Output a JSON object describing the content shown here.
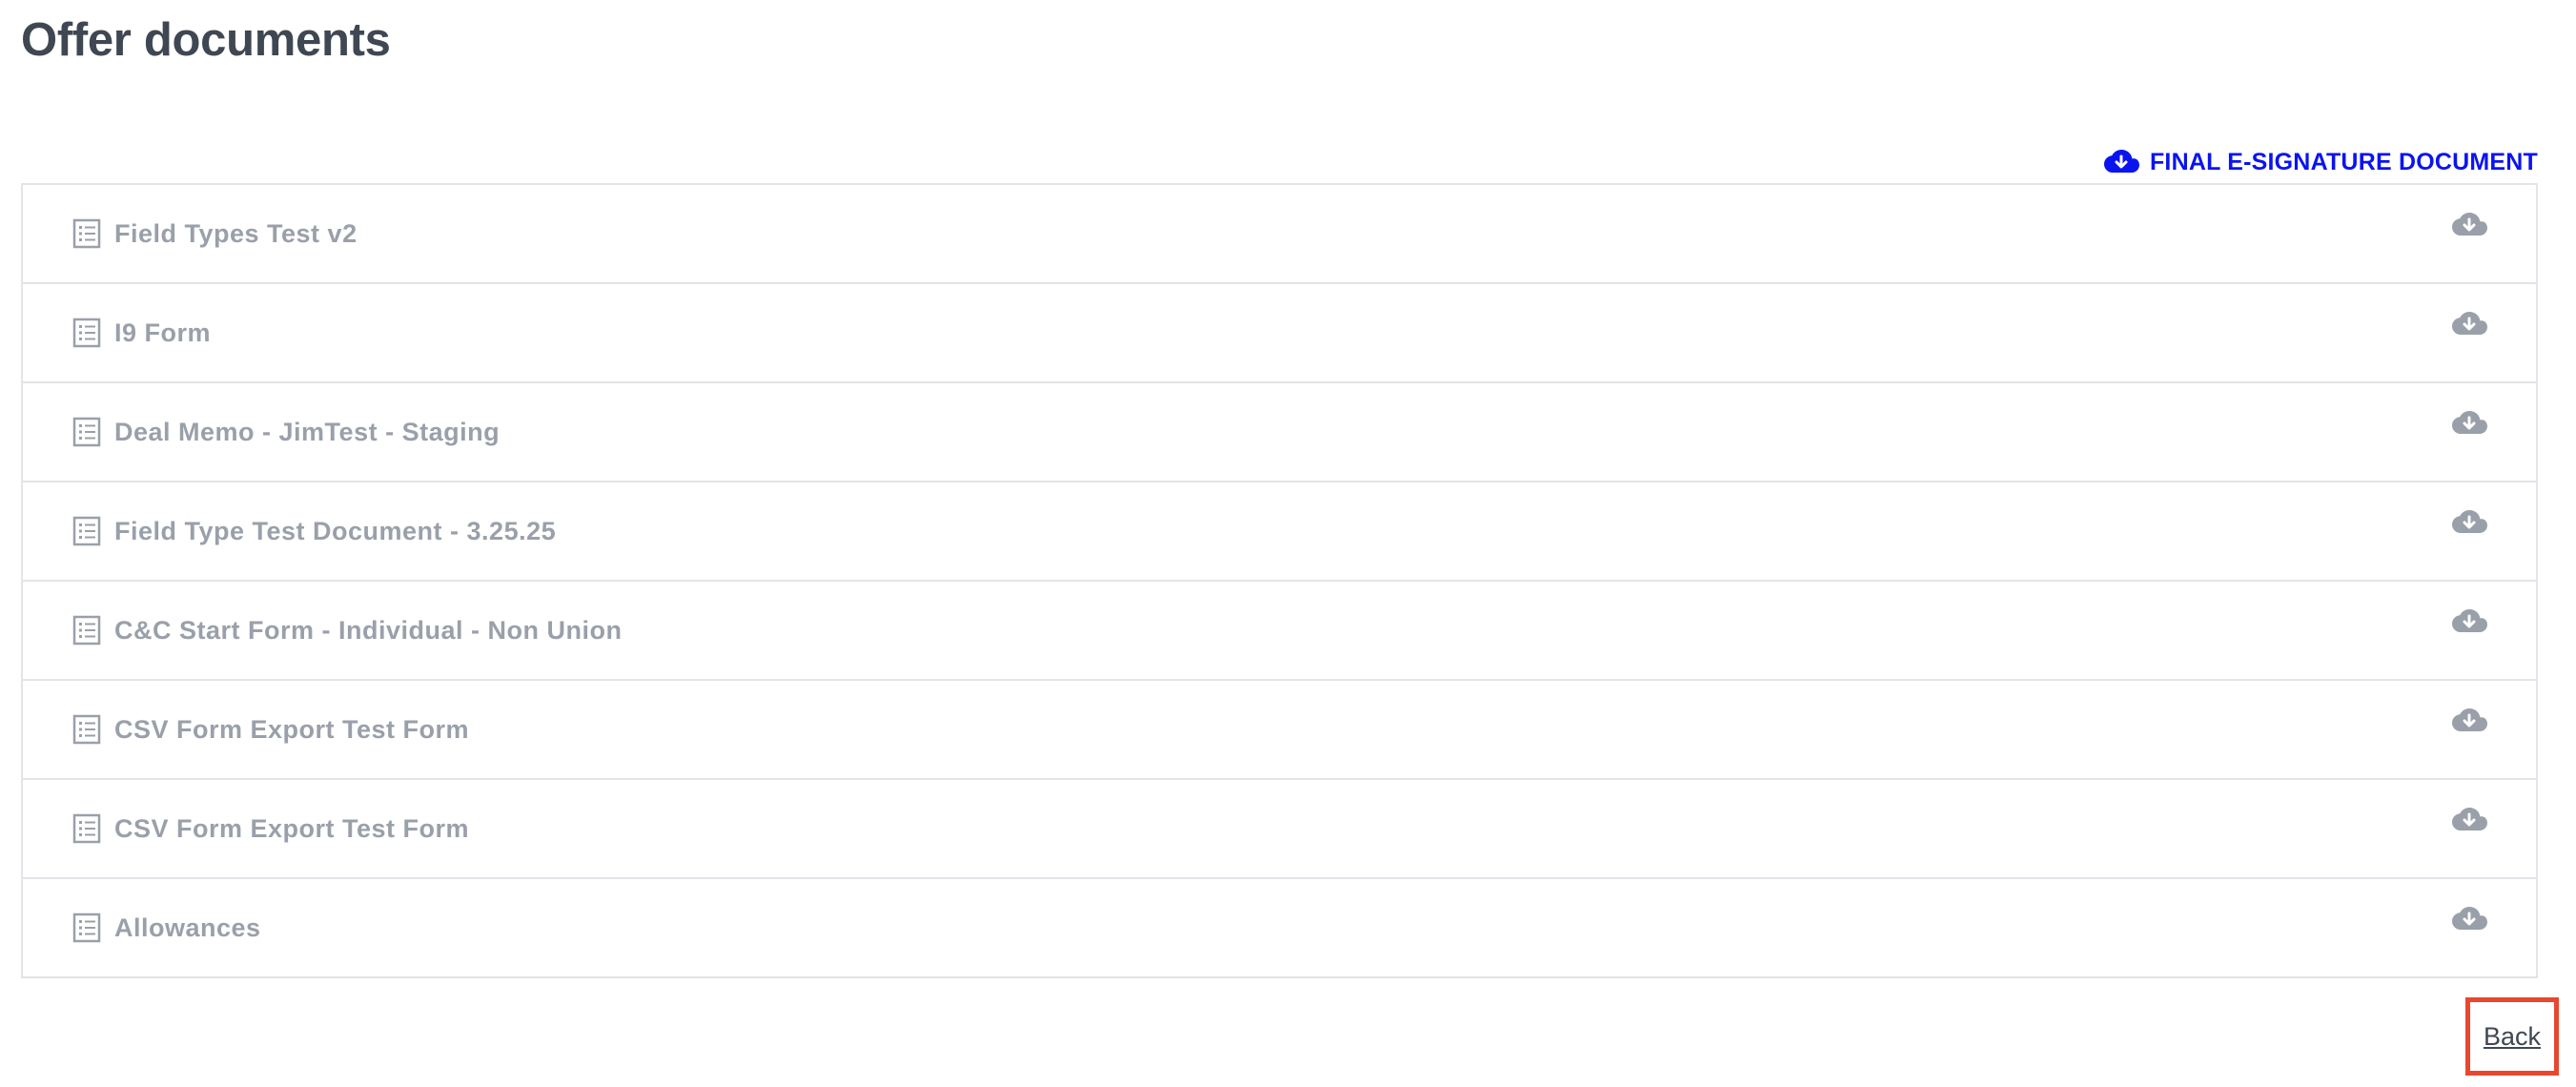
{
  "page": {
    "title": "Offer documents"
  },
  "final_document": {
    "label": "FINAL E-SIGNATURE DOCUMENT",
    "icon": "cloud-download-icon",
    "color": "#0a14f0"
  },
  "documents": [
    {
      "name": "Field Types Test v2",
      "icon": "document-list-icon",
      "action_icon": "cloud-download-icon"
    },
    {
      "name": "I9 Form",
      "icon": "document-list-icon",
      "action_icon": "cloud-download-icon"
    },
    {
      "name": "Deal Memo - JimTest - Staging",
      "icon": "document-list-icon",
      "action_icon": "cloud-download-icon"
    },
    {
      "name": "Field Type Test Document - 3.25.25",
      "icon": "document-list-icon",
      "action_icon": "cloud-download-icon"
    },
    {
      "name": "C&C Start Form - Individual - Non Union",
      "icon": "document-list-icon",
      "action_icon": "cloud-download-icon"
    },
    {
      "name": "CSV Form Export Test Form",
      "icon": "document-list-icon",
      "action_icon": "cloud-download-icon"
    },
    {
      "name": "CSV Form Export Test Form",
      "icon": "document-list-icon",
      "action_icon": "cloud-download-icon"
    },
    {
      "name": "Allowances",
      "icon": "document-list-icon",
      "action_icon": "cloud-download-icon"
    }
  ],
  "footer": {
    "back_label": "Back",
    "highlight_color": "#e8472f"
  }
}
